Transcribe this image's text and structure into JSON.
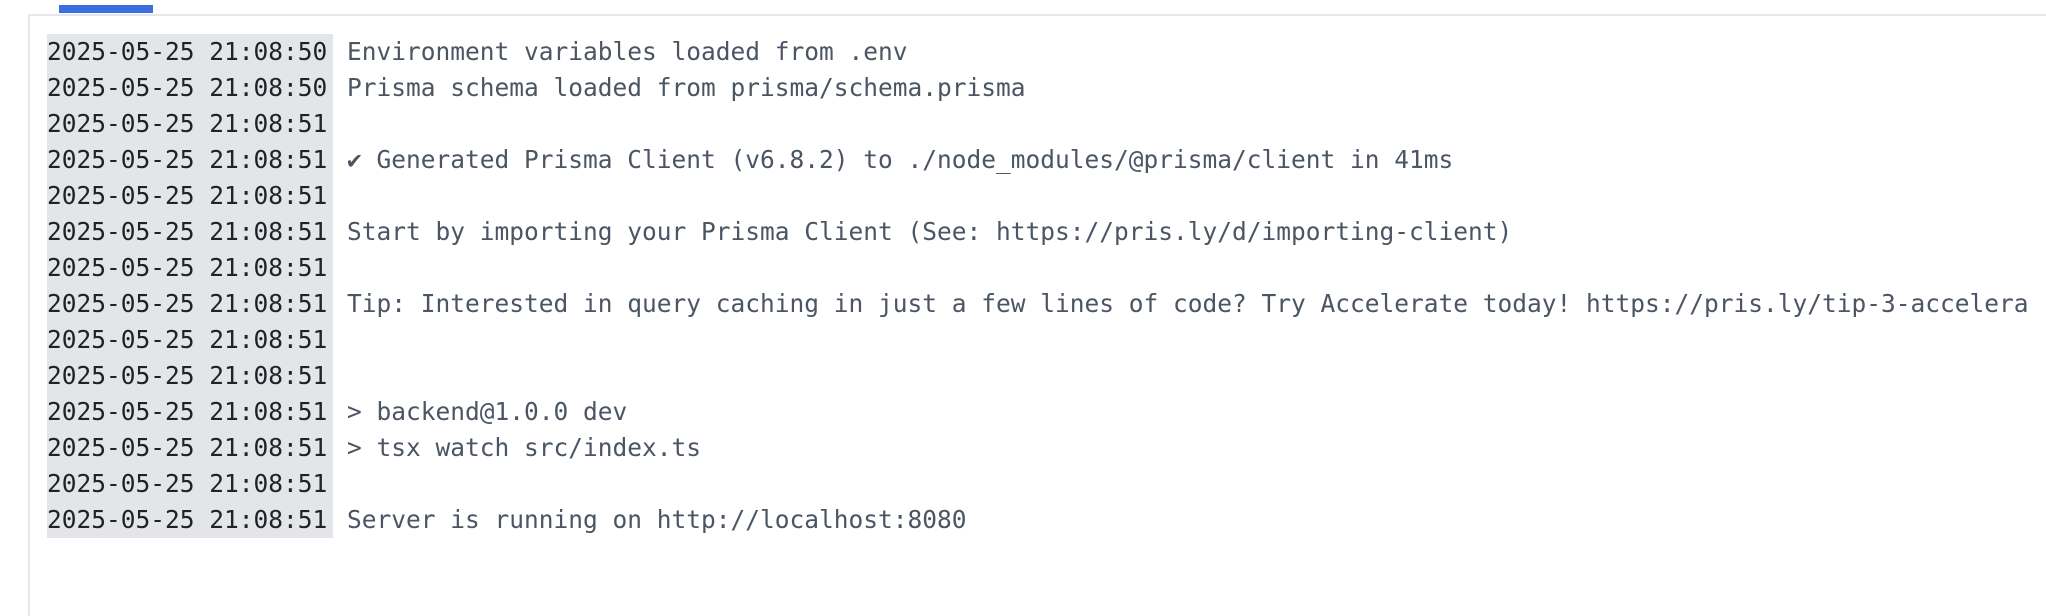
{
  "log": {
    "lines": [
      {
        "timestamp": "2025-05-25 21:08:50",
        "message": "Environment variables loaded from .env"
      },
      {
        "timestamp": "2025-05-25 21:08:50",
        "message": "Prisma schema loaded from prisma/schema.prisma"
      },
      {
        "timestamp": "2025-05-25 21:08:51",
        "message": ""
      },
      {
        "timestamp": "2025-05-25 21:08:51",
        "message": "✔ Generated Prisma Client (v6.8.2) to ./node_modules/@prisma/client in 41ms"
      },
      {
        "timestamp": "2025-05-25 21:08:51",
        "message": ""
      },
      {
        "timestamp": "2025-05-25 21:08:51",
        "message": "Start by importing your Prisma Client (See: https://pris.ly/d/importing-client)"
      },
      {
        "timestamp": "2025-05-25 21:08:51",
        "message": ""
      },
      {
        "timestamp": "2025-05-25 21:08:51",
        "message": "Tip: Interested in query caching in just a few lines of code? Try Accelerate today! https://pris.ly/tip-3-accelera"
      },
      {
        "timestamp": "2025-05-25 21:08:51",
        "message": ""
      },
      {
        "timestamp": "2025-05-25 21:08:51",
        "message": ""
      },
      {
        "timestamp": "2025-05-25 21:08:51",
        "message": "> backend@1.0.0 dev"
      },
      {
        "timestamp": "2025-05-25 21:08:51",
        "message": "> tsx watch src/index.ts"
      },
      {
        "timestamp": "2025-05-25 21:08:51",
        "message": ""
      },
      {
        "timestamp": "2025-05-25 21:08:51",
        "message": "Server is running on http://localhost:8080"
      }
    ]
  },
  "colors": {
    "accent": "#3b6fe0",
    "timestamp_bg": "#e4e5e8",
    "message_text": "#4b5563",
    "border": "#e5e7eb"
  }
}
